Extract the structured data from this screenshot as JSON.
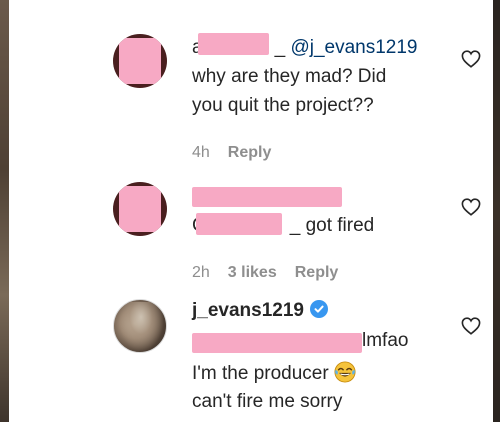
{
  "comments": [
    {
      "mention": "@j_evans1219",
      "lead_char": "a",
      "underscore": "_",
      "line1": "why are they mad? Did",
      "line2": "you quit the project??",
      "time": "4h",
      "reply_label": "Reply"
    },
    {
      "lead_char": "C",
      "trailing": "_ got fired",
      "time": "2h",
      "likes": "3 likes",
      "reply_label": "Reply"
    },
    {
      "username": "j_evans1219",
      "tail": "lmfao",
      "line2": "I'm the producer",
      "line3": "can't fire me sorry",
      "emoji": "😂"
    }
  ],
  "icons": {
    "heart": "heart-outline-icon",
    "verified": "verified-badge-icon",
    "emoji": "tears-of-joy-emoji"
  },
  "colors": {
    "mention": "#00376b",
    "meta": "#8e8e8e",
    "verified": "#3897f0",
    "redaction": "#f7a9c4"
  }
}
